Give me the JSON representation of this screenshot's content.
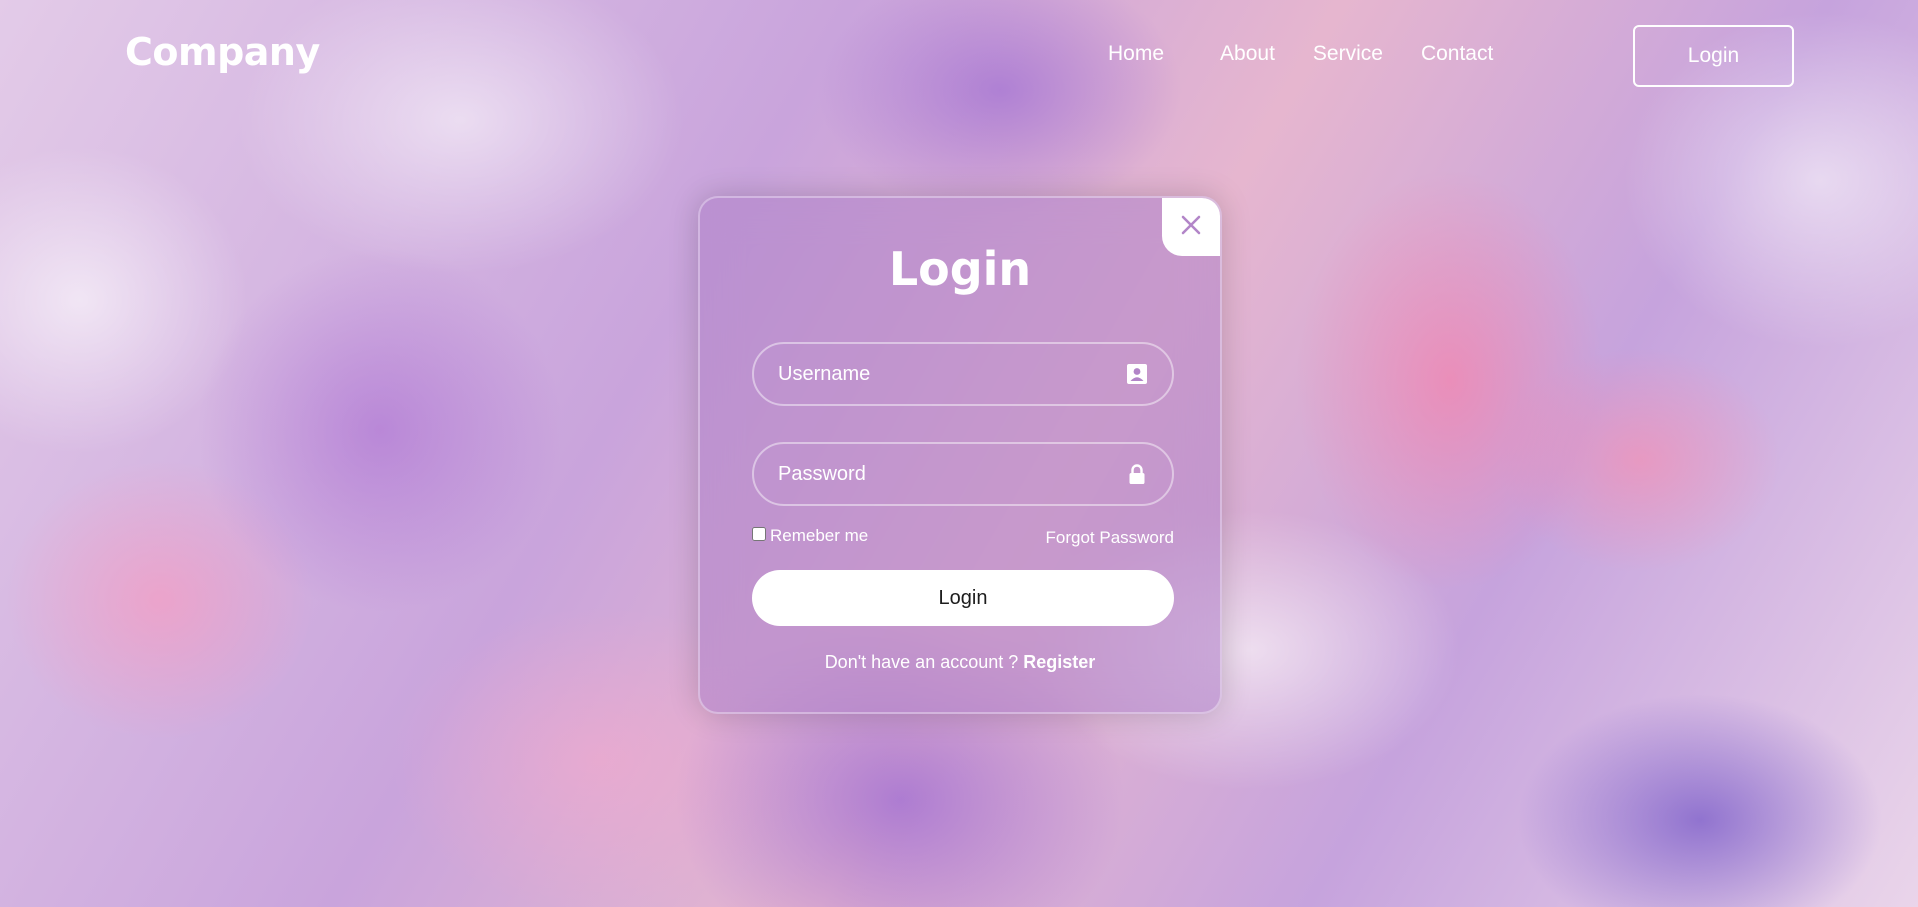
{
  "header": {
    "logo": "Company",
    "nav": [
      "Home",
      "About",
      "Service",
      "Contact"
    ],
    "login_button": "Login"
  },
  "modal": {
    "title": "Login",
    "close_icon": "close-icon",
    "username": {
      "placeholder": "Username",
      "value": "",
      "icon": "user-card-icon"
    },
    "password": {
      "placeholder": "Password",
      "value": "",
      "icon": "lock-icon"
    },
    "remember_label": "Remeber me",
    "forgot_label": "Forgot Password",
    "submit_label": "Login",
    "register_prompt": "Don't have an account ?",
    "register_link": "Register"
  },
  "colors": {
    "accent": "#ffffff",
    "modal_tint": "#af82c8",
    "icon_color": "#b285c8"
  }
}
